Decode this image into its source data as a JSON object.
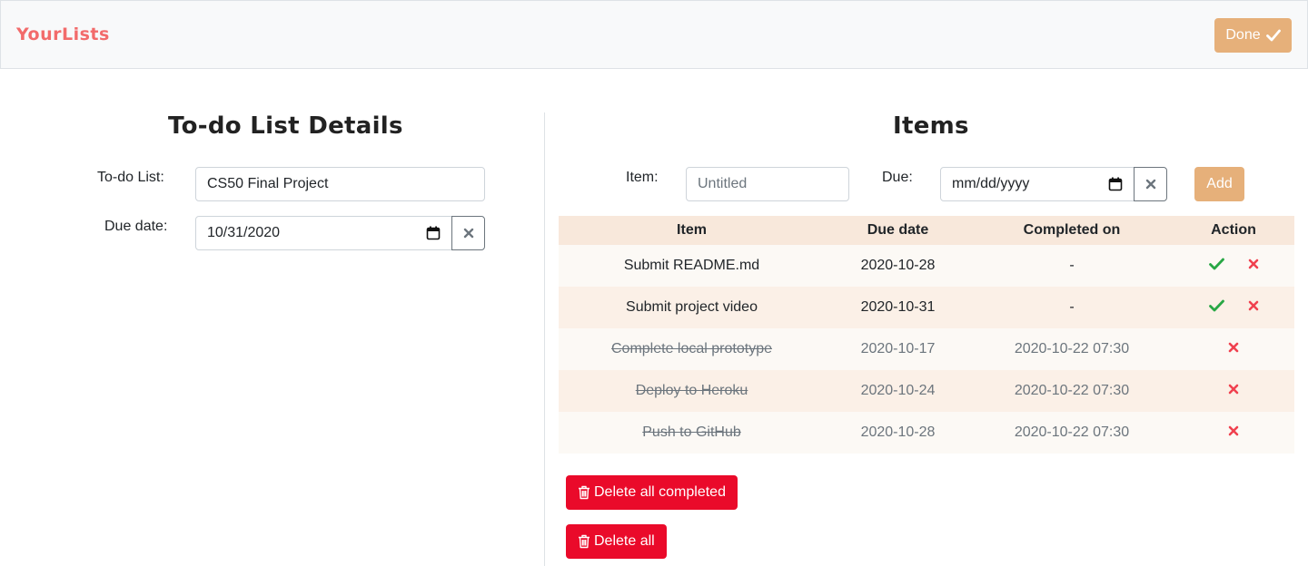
{
  "navbar": {
    "brand": "YourLists",
    "done_label": "Done"
  },
  "details": {
    "heading": "To-do List Details",
    "list_label": "To-do List:",
    "list_value": "CS50 Final Project",
    "due_label": "Due date:",
    "due_value": "10/31/2020"
  },
  "items": {
    "heading": "Items",
    "item_label": "Item:",
    "item_placeholder": "Untitled",
    "due_label": "Due:",
    "due_placeholder": "mm/dd/yyyy",
    "add_label": "Add",
    "columns": [
      "Item",
      "Due date",
      "Completed on",
      "Action"
    ],
    "rows": [
      {
        "item": "Submit README.md",
        "due": "2020-10-28",
        "completed": "-",
        "done": false
      },
      {
        "item": "Submit project video",
        "due": "2020-10-31",
        "completed": "-",
        "done": false
      },
      {
        "item": "Complete local prototype",
        "due": "2020-10-17",
        "completed": "2020-10-22 07:30",
        "done": true
      },
      {
        "item": "Deploy to Heroku",
        "due": "2020-10-24",
        "completed": "2020-10-22 07:30",
        "done": true
      },
      {
        "item": "Push to GitHub",
        "due": "2020-10-28",
        "completed": "2020-10-22 07:30",
        "done": true
      }
    ],
    "delete_completed_label": "Delete all completed",
    "delete_all_label": "Delete all"
  },
  "colors": {
    "brand": "#f26b6b",
    "accent": "#e6b07a",
    "danger": "#ea0a2a",
    "check": "#28a745",
    "cross": "#f0414f"
  },
  "icons": {
    "done": "check-icon",
    "calendar": "calendar-icon",
    "clear": "close-icon",
    "complete": "check-icon",
    "remove": "cross-icon",
    "trash": "trash-icon"
  }
}
